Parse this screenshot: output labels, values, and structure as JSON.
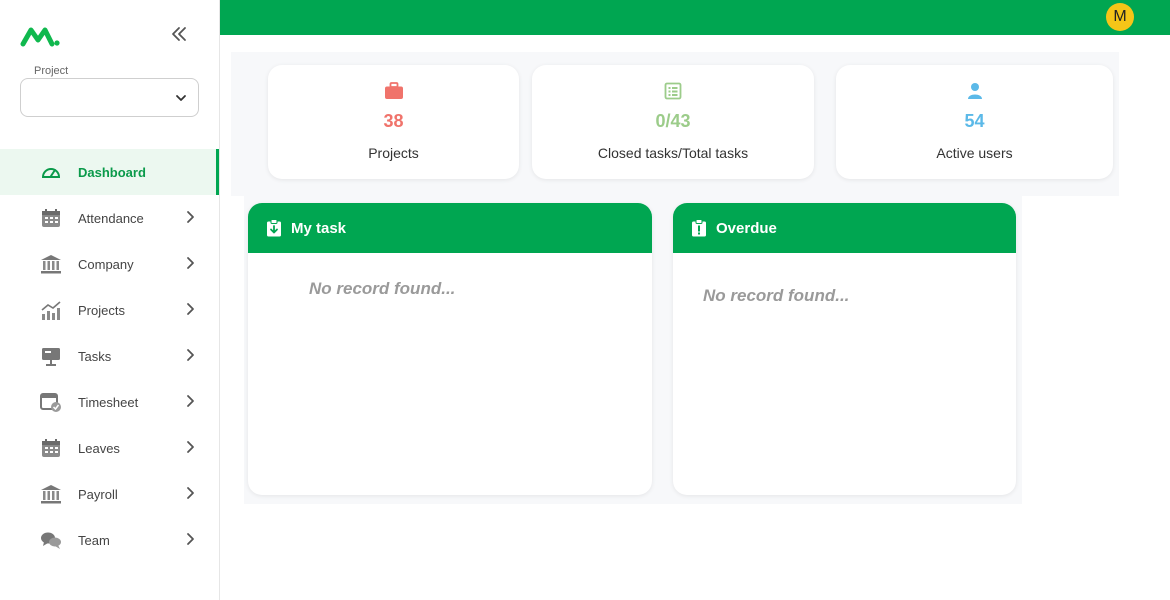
{
  "sidebar": {
    "project_label": "Project",
    "project_value": "",
    "items": [
      {
        "label": "Dashboard",
        "icon": "dashboard-gauge-icon",
        "active": true
      },
      {
        "label": "Attendance",
        "icon": "calendar-icon"
      },
      {
        "label": "Company",
        "icon": "bank-building-icon"
      },
      {
        "label": "Projects",
        "icon": "chart-bars-icon"
      },
      {
        "label": "Tasks",
        "icon": "monitor-presentation-icon"
      },
      {
        "label": "Timesheet",
        "icon": "calendar-check-icon"
      },
      {
        "label": "Leaves",
        "icon": "calendar-icon"
      },
      {
        "label": "Payroll",
        "icon": "bank-building-icon"
      },
      {
        "label": "Team",
        "icon": "chat-bubbles-icon"
      }
    ]
  },
  "header": {
    "avatar_initial": "M"
  },
  "stats": [
    {
      "value": "38",
      "label": "Projects",
      "color": "#f0736b",
      "icon": "briefcase-icon"
    },
    {
      "value": "0/43",
      "label": "Closed tasks/Total tasks",
      "color": "#9ccc8a",
      "icon": "list-document-icon"
    },
    {
      "value": "54",
      "label": "Active users",
      "color": "#5bb9e8",
      "icon": "user-icon"
    }
  ],
  "panels": {
    "my_task": {
      "title": "My task",
      "empty_text": "No record found...",
      "icon": "clipboard-download-icon"
    },
    "overdue": {
      "title": "Overdue",
      "empty_text": "No record found...",
      "icon": "clipboard-alert-icon"
    }
  },
  "colors": {
    "brand_green": "#00a651",
    "avatar_yellow": "#f5c518"
  }
}
